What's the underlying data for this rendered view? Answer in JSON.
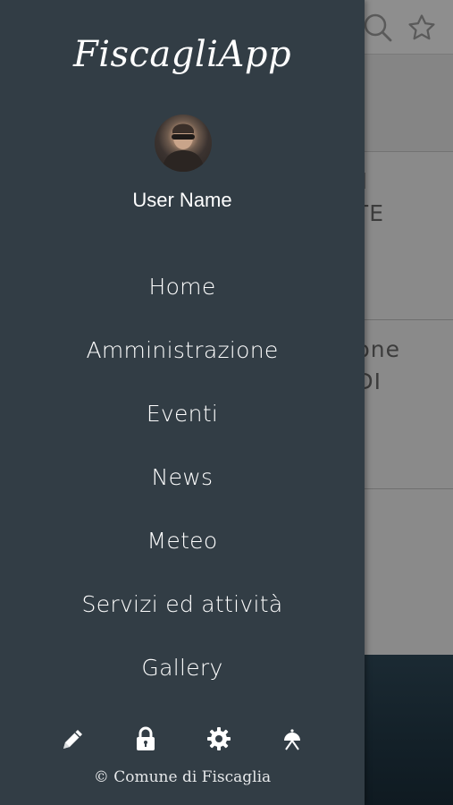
{
  "drawer": {
    "app_title": "FiscagliApp",
    "user_name": "User Name",
    "menu_items": [
      {
        "label": "Home"
      },
      {
        "label": "Amministrazione"
      },
      {
        "label": "Eventi"
      },
      {
        "label": "News"
      },
      {
        "label": "Meteo"
      },
      {
        "label": "Servizi ed attività"
      },
      {
        "label": "Gallery"
      }
    ],
    "bottom_icons": [
      "pencil-icon",
      "lock-icon",
      "gear-icon",
      "satellite-dish-icon"
    ],
    "copyright": "© Comune di Fiscaglia"
  },
  "background": {
    "card1_line1": "I",
    "card1_line2": "TE",
    "card2_line1": "one",
    "card2_line2": "DI",
    "header_icons": [
      "search-icon",
      "star-icon"
    ]
  },
  "colors": {
    "drawer_bg": "#323d45",
    "drawer_text": "#ffffff",
    "overlay_gray": "#8a8a8a"
  }
}
